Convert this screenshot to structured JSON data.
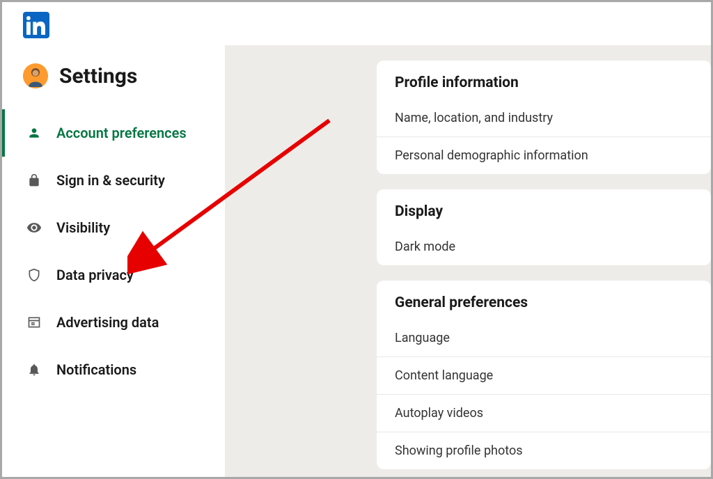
{
  "brand": {
    "name": "LinkedIn",
    "logo_letter": "in",
    "color": "#0a66c2"
  },
  "sidebar": {
    "title": "Settings",
    "items": [
      {
        "label": "Account preferences",
        "icon": "person-icon",
        "active": true
      },
      {
        "label": "Sign in & security",
        "icon": "lock-icon",
        "active": false
      },
      {
        "label": "Visibility",
        "icon": "eye-icon",
        "active": false
      },
      {
        "label": "Data privacy",
        "icon": "shield-icon",
        "active": false
      },
      {
        "label": "Advertising data",
        "icon": "newspaper-icon",
        "active": false
      },
      {
        "label": "Notifications",
        "icon": "bell-icon",
        "active": false
      }
    ]
  },
  "main": {
    "sections": [
      {
        "title": "Profile information",
        "items": [
          "Name, location, and industry",
          "Personal demographic information"
        ]
      },
      {
        "title": "Display",
        "items": [
          "Dark mode"
        ]
      },
      {
        "title": "General preferences",
        "items": [
          "Language",
          "Content language",
          "Autoplay videos",
          "Showing profile photos"
        ]
      }
    ]
  },
  "annotation": {
    "arrow_color": "#e60000"
  }
}
